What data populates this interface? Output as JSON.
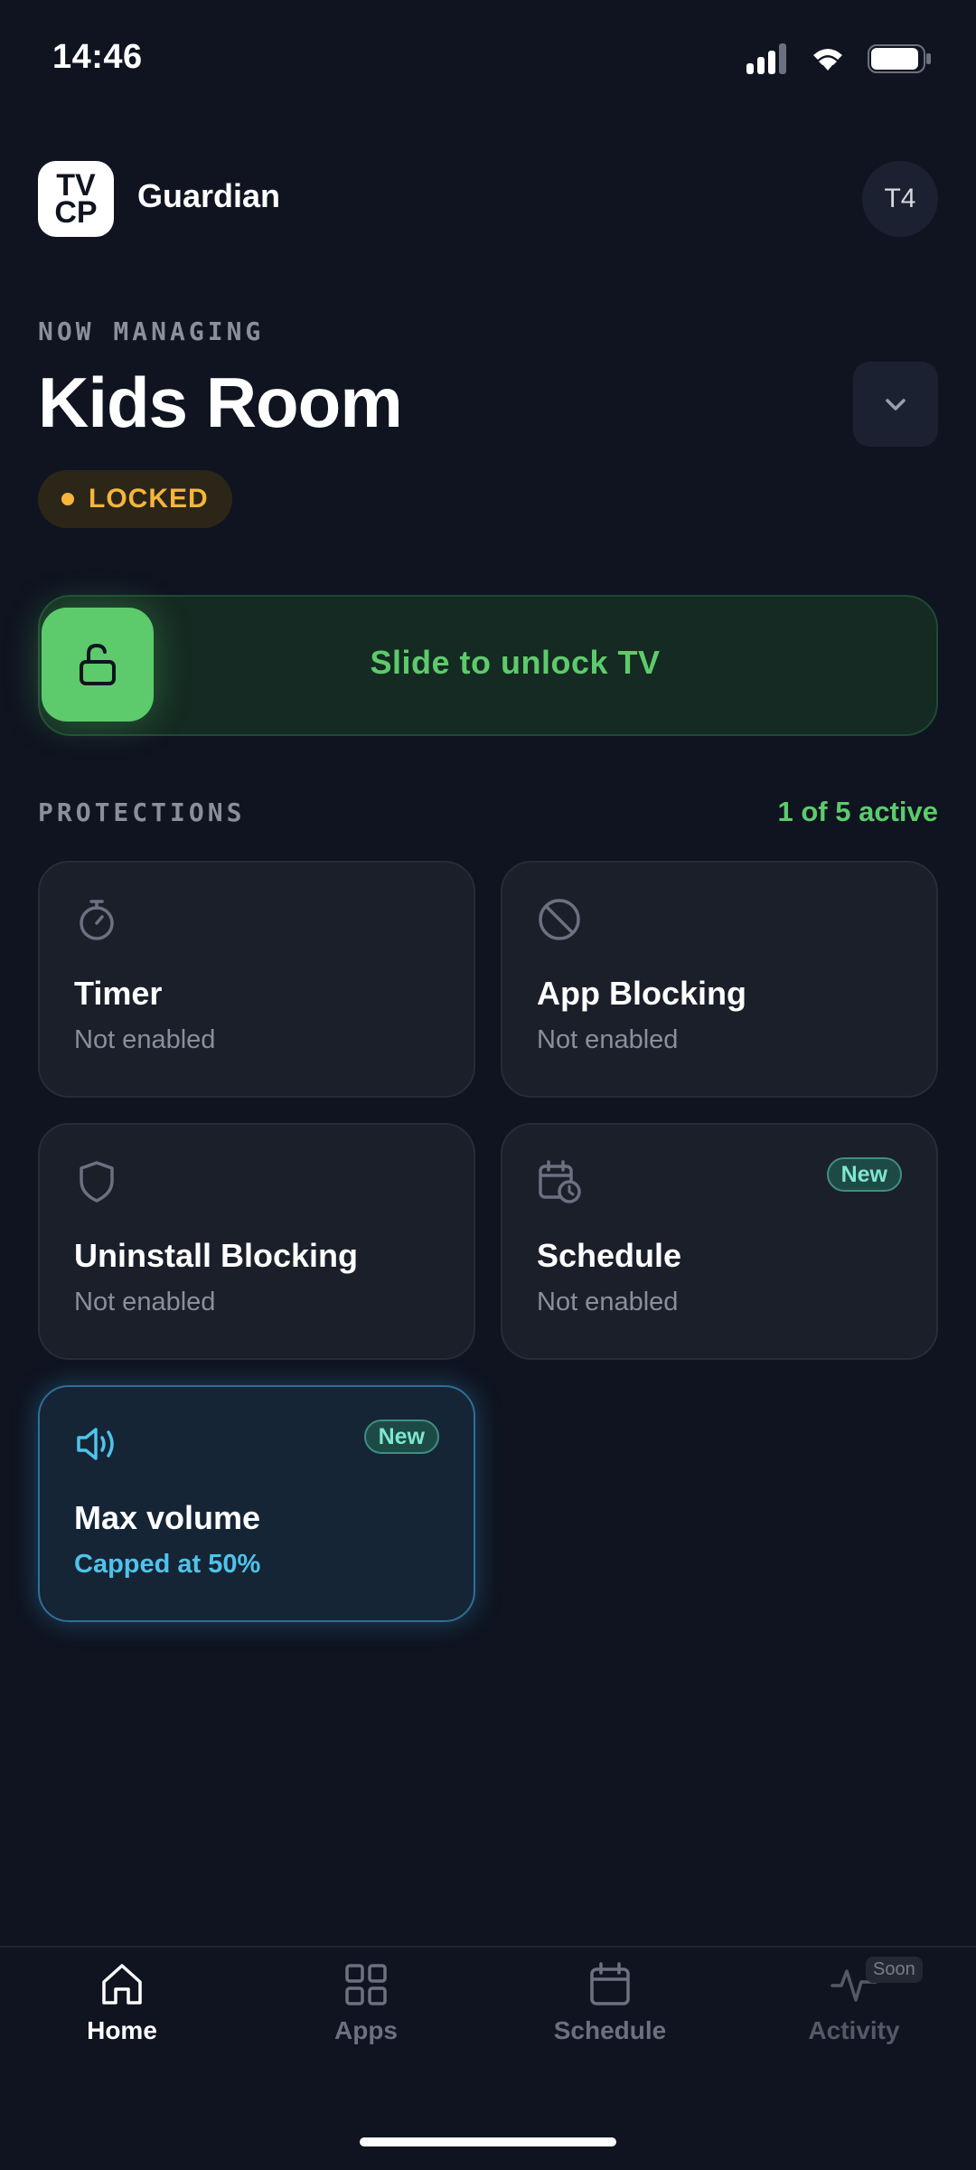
{
  "status_bar": {
    "time": "14:46"
  },
  "header": {
    "logo_text": "TV CP",
    "app_name": "Guardian",
    "avatar_initials": "T4"
  },
  "managing": {
    "eyebrow": "NOW MANAGING",
    "device_name": "Kids Room",
    "status": "LOCKED",
    "status_color": "#f5b53d"
  },
  "unlock": {
    "label": "Slide to unlock TV",
    "accent": "#5dcb6b"
  },
  "protections": {
    "section_label": "PROTECTIONS",
    "active_count": "1 of 5 active",
    "cards": [
      {
        "title": "Timer",
        "subtitle": "Not enabled",
        "icon": "stopwatch-icon"
      },
      {
        "title": "App Blocking",
        "subtitle": "Not enabled",
        "icon": "block-icon"
      },
      {
        "title": "Uninstall Blocking",
        "subtitle": "Not enabled",
        "icon": "shield-icon"
      },
      {
        "title": "Schedule",
        "subtitle": "Not enabled",
        "icon": "calendar-clock-icon",
        "badge": "New"
      },
      {
        "title": "Max volume",
        "subtitle": "Capped at 50%",
        "icon": "volume-icon",
        "badge": "New"
      }
    ]
  },
  "nav": {
    "items": [
      {
        "label": "Home",
        "icon": "home-icon"
      },
      {
        "label": "Apps",
        "icon": "grid-icon"
      },
      {
        "label": "Schedule",
        "icon": "calendar-icon"
      },
      {
        "label": "Activity",
        "icon": "activity-icon",
        "badge": "Soon"
      }
    ]
  }
}
